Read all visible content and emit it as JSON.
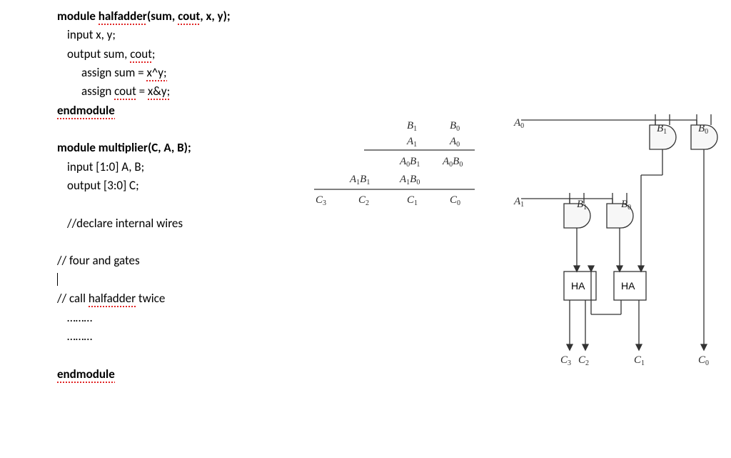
{
  "code": {
    "l1a": "module ",
    "l1b": "halfadder",
    "l1c": "(sum, ",
    "l1d": "cout",
    "l1e": ", x, y);",
    "l2": "input x, y;",
    "l3a": "output sum, ",
    "l3b": "cout",
    "l3c": ";",
    "l4a": "assign sum = ",
    "l4b": "x^y;",
    "l5a": "assign ",
    "l5b": "cout",
    "l5c": " = ",
    "l5d": "x&y;",
    "l6": "endmodule",
    "l8": "module multiplier(C, A, B);",
    "l9": "input [1:0] A, B;",
    "l10": "output [3:0] C;",
    "l12": "//declare internal wires",
    "l14": "// four and gates",
    "l15": "",
    "l16a": "// call ",
    "l16b": "halfadder",
    "l16c": " twice",
    "l17": "………",
    "l18": "………",
    "l20": "endmodule"
  },
  "table": {
    "r1": {
      "c1": "",
      "c2": "",
      "c3": "B1",
      "c4": "B0"
    },
    "r2": {
      "c1": "",
      "c2": "",
      "c3": "A1",
      "c4": "A0"
    },
    "r3": {
      "c1": "",
      "c2": "",
      "c3": "A0B1",
      "c4": "A0B0"
    },
    "r4": {
      "c1": "",
      "c2": "A1B1",
      "c3": "A1B0",
      "c4": ""
    },
    "r5": {
      "c1": "C3",
      "c2": "C2",
      "c3": "C1",
      "c4": "C0"
    }
  },
  "circuit": {
    "in_A0": "A0",
    "in_B1": "B1",
    "in_B0": "B0",
    "in_A1": "A1",
    "in_B1b": "B1",
    "in_B0b": "B0",
    "ha": "HA",
    "out_c3": "C3",
    "out_c2": "C2",
    "out_c1": "C1",
    "out_c0": "C0"
  }
}
